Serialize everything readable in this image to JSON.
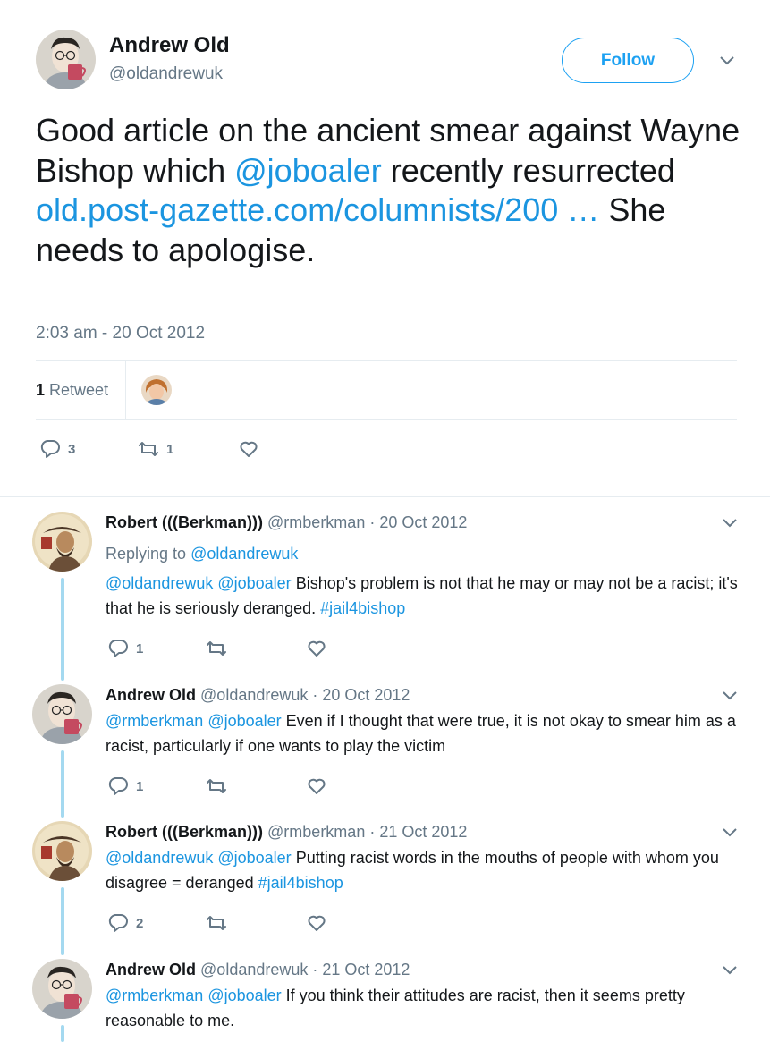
{
  "main_tweet": {
    "name": "Andrew Old",
    "handle": "@oldandrewuk",
    "follow_label": "Follow",
    "text_1": "Good article on the ancient smear against Wayne Bishop which ",
    "mention": "@joboaler",
    "text_2": " recently resurrected  ",
    "link": "old.post-gazette.com/columnists/200 …",
    "text_3": " She needs to apologise.",
    "timestamp": "2:03 am - 20 Oct 2012",
    "retweet_count": "1",
    "retweet_label": "Retweet",
    "replies": "3",
    "retweets": "1"
  },
  "replies": [
    {
      "name": "Robert (((Berkman)))",
      "meta": "@rmberkman · 20 Oct 2012",
      "replying_label": "Replying to ",
      "replying_to": "@oldandrewuk",
      "mention1": "@oldandrewuk",
      "mention2": "@joboaler",
      "text": " Bishop's problem is not that he may or may not be a racist; it's that he is seriously deranged. ",
      "hashtag": "#jail4bishop",
      "reply_count": "1"
    },
    {
      "name": "Andrew Old",
      "meta": "@oldandrewuk · 20 Oct 2012",
      "mention1": "@rmberkman",
      "mention2": "@joboaler",
      "text": " Even if I thought that were true, it is not okay to smear him as a racist, particularly if one wants to play the victim",
      "reply_count": "1"
    },
    {
      "name": "Robert (((Berkman)))",
      "meta": "@rmberkman · 21 Oct 2012",
      "mention1": "@oldandrewuk",
      "mention2": "@joboaler",
      "text": " Putting racist words in the mouths of people with whom you disagree = deranged ",
      "hashtag": "#jail4bishop",
      "reply_count": "2"
    },
    {
      "name": "Andrew Old",
      "meta": "@oldandrewuk · 21 Oct 2012",
      "mention1": "@rmberkman",
      "mention2": "@joboaler",
      "text": " If you think their attitudes are racist, then it seems pretty reasonable to me."
    }
  ],
  "colors": {
    "accent": "#1da1f2",
    "link": "#1b95e0",
    "text": "#14171a",
    "muted": "#657786",
    "border": "#e6ecf0",
    "thread": "#a4d9f0"
  },
  "icons": [
    "chevron-down-icon",
    "reply-icon",
    "retweet-icon",
    "like-icon"
  ]
}
